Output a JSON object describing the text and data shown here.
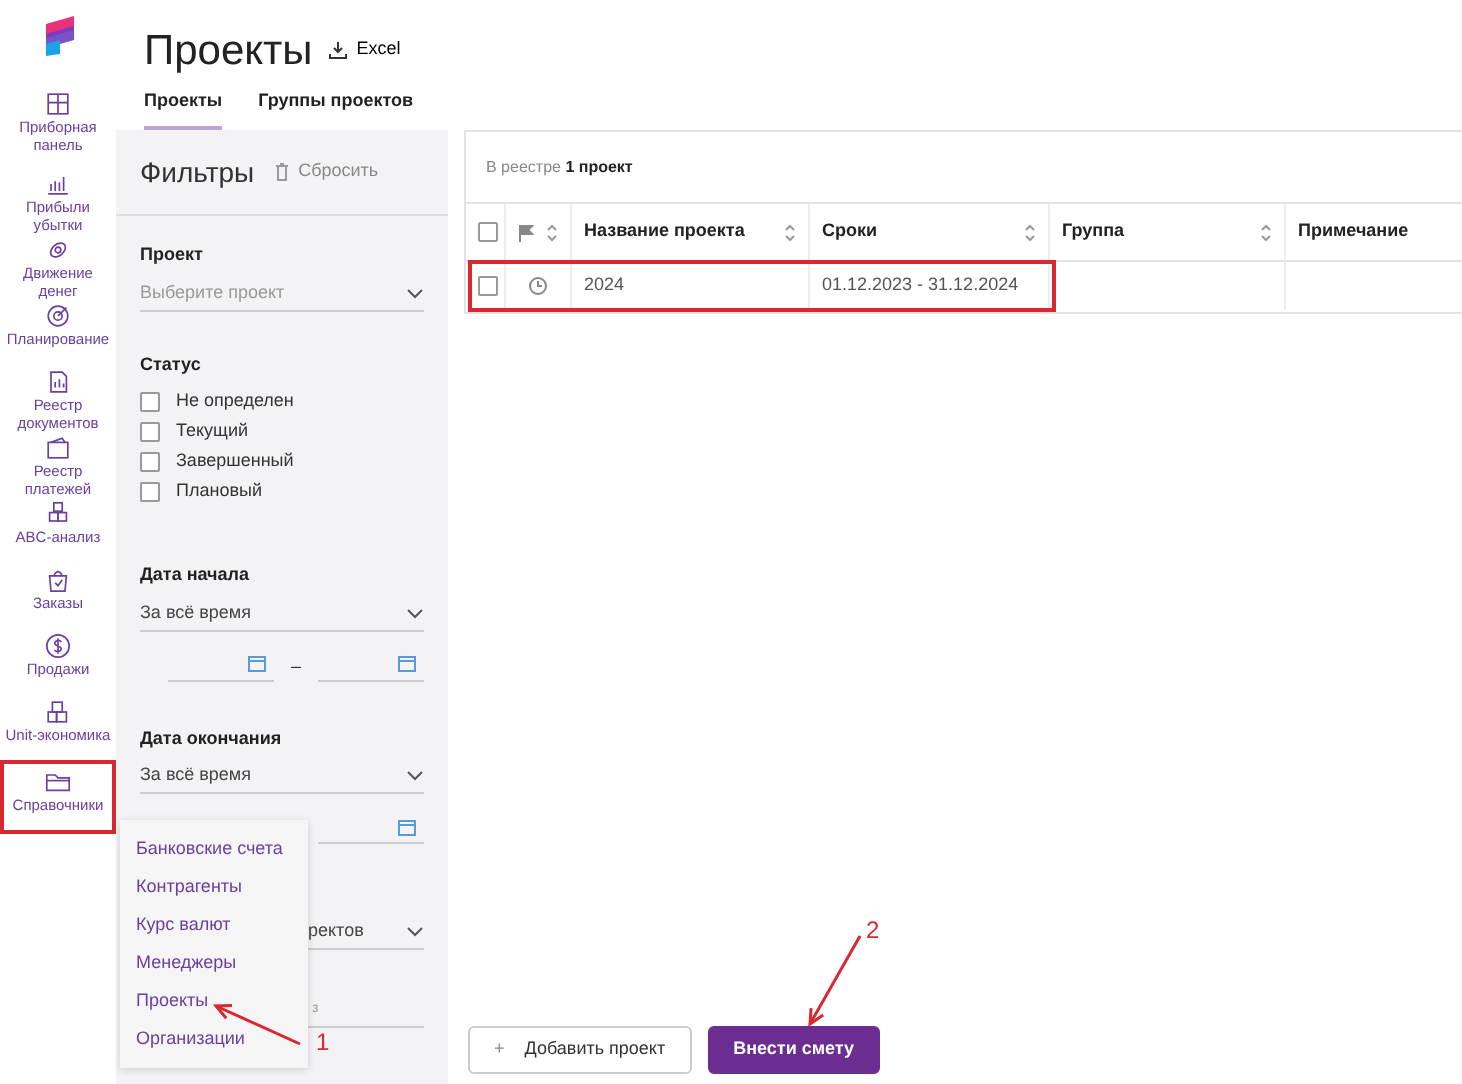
{
  "header": {
    "title": "Проекты",
    "export": "Excel"
  },
  "tabs": [
    {
      "label": "Проекты",
      "selected": true
    },
    {
      "label": "Группы проектов",
      "selected": false
    }
  ],
  "sidebar": {
    "items": [
      {
        "kind": "dashboard",
        "label": "Приборная панель",
        "highlighted": false
      },
      {
        "kind": "chart",
        "label": "Прибыли убытки",
        "highlighted": false
      },
      {
        "kind": "money",
        "label": "Движение денег",
        "highlighted": false
      },
      {
        "kind": "target",
        "label": "Планирование",
        "highlighted": false
      },
      {
        "kind": "docs",
        "label": "Реестр документов",
        "highlighted": false
      },
      {
        "kind": "wallet",
        "label": "Реестр платежей",
        "highlighted": false
      },
      {
        "kind": "abc",
        "label": "ABC-анализ",
        "highlighted": false
      },
      {
        "kind": "bag",
        "label": "Заказы",
        "highlighted": false
      },
      {
        "kind": "dollar",
        "label": "Продажи",
        "highlighted": false
      },
      {
        "kind": "boxes",
        "label": "Unit-экономика",
        "highlighted": false
      },
      {
        "kind": "folder",
        "label": "Справочники",
        "highlighted": true
      }
    ]
  },
  "filters": {
    "title": "Фильтры",
    "reset": "Сбросить",
    "groups": [
      {
        "kind": "select",
        "label": "Проект",
        "placeholder": "Выберите проект"
      },
      {
        "kind": "checks",
        "label": "Статус",
        "options": [
          {
            "label": "Не определен",
            "checked": false
          },
          {
            "label": "Текущий",
            "checked": false
          },
          {
            "label": "Завершенный",
            "checked": false
          },
          {
            "label": "Плановый",
            "checked": false
          }
        ]
      },
      {
        "kind": "select",
        "label": "Дата начала",
        "value": "За всё время"
      },
      {
        "kind": "daterange",
        "separator": "–"
      },
      {
        "kind": "select",
        "label": "Дата окончания",
        "value": "За всё время"
      },
      {
        "kind": "daterange_partial"
      },
      {
        "kind": "select_partial",
        "value": "ректов"
      },
      {
        "kind": "field_partial",
        "placeholder": "з"
      }
    ]
  },
  "menu": {
    "items": [
      "Банковские счета",
      "Контрагенты",
      "Курс валют",
      "Менеджеры",
      "Проекты",
      "Организации"
    ]
  },
  "table": {
    "summary": "В реестре **1 проект**",
    "columns": [
      {
        "kind": "check",
        "checked": false
      },
      {
        "kind": "flag"
      },
      {
        "kind": "text",
        "label": "Название проекта"
      },
      {
        "kind": "text",
        "label": "Сроки"
      },
      {
        "kind": "text",
        "label": "Группа"
      },
      {
        "kind": "plain",
        "label": "Примечание"
      }
    ],
    "rows": [
      {
        "checked": false,
        "highlighted": true,
        "name": "2024",
        "dates": "01.12.2023 - 31.12.2024"
      }
    ]
  },
  "buttons": [
    {
      "kind": "outline",
      "icon": "+",
      "label": "Добавить проект"
    },
    {
      "kind": "primary",
      "label": "Внести смету"
    }
  ],
  "annotations": [
    {
      "label": "1"
    },
    {
      "label": "2"
    }
  ]
}
